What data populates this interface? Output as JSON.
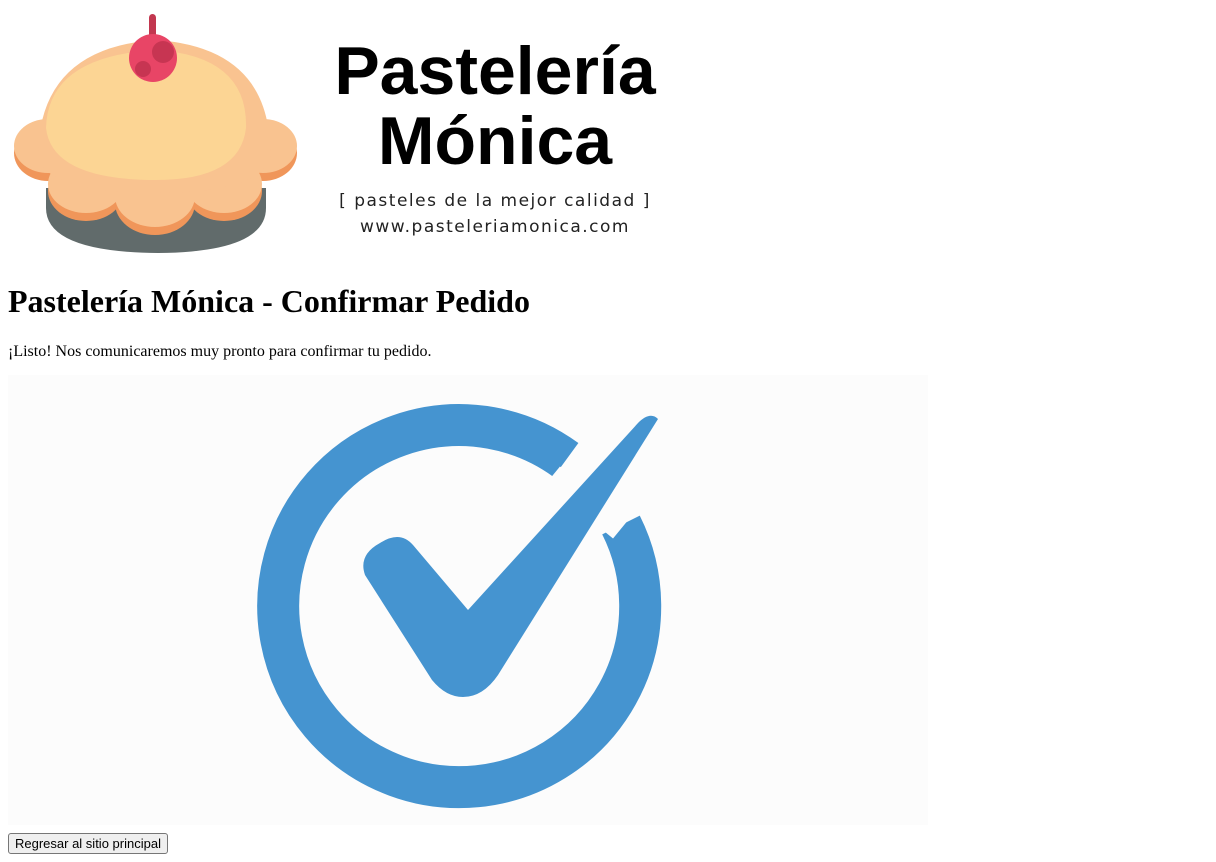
{
  "brand": {
    "name_line1": "Pastelería",
    "name_line2": "Mónica",
    "tagline": "[ pasteles de la mejor calidad ]",
    "url": "www.pasteleriamonica.com",
    "logo_icon": "cupcake-icon",
    "colors": {
      "frosting_light": "#fcd594",
      "frosting": "#f9c390",
      "frosting_shadow": "#f0965a",
      "cup": "#616b6b",
      "cherry": "#e84566",
      "cherry_dark": "#c1324f",
      "stem": "#c2374f"
    }
  },
  "page": {
    "title": "Pastelería Mónica - Confirmar Pedido",
    "message": "¡Listo! Nos comunicaremos muy pronto para confirmar tu pedido."
  },
  "confirmation_image": {
    "icon": "check-circle-icon",
    "color": "#4594d0"
  },
  "actions": {
    "back_label": "Regresar al sitio principal"
  }
}
